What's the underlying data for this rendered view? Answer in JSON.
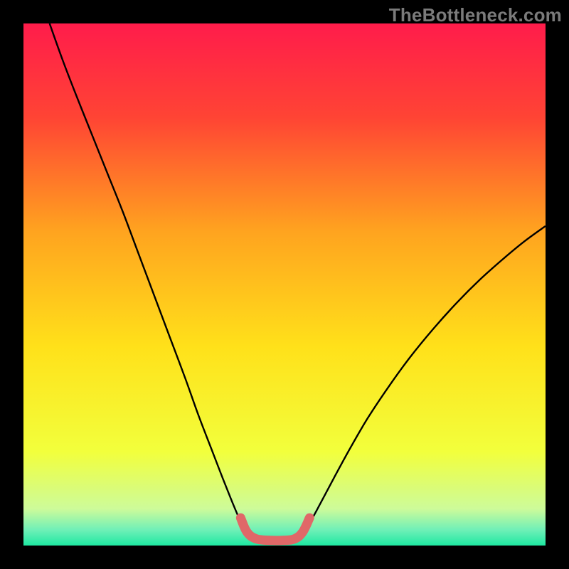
{
  "watermark": {
    "text": "TheBottleneck.com"
  },
  "chart_data": {
    "type": "line",
    "title": "",
    "xlabel": "",
    "ylabel": "",
    "xlim": [
      0,
      1
    ],
    "ylim": [
      0,
      1
    ],
    "grid": false,
    "legend": false,
    "background_gradient_stops": [
      {
        "offset": 0.0,
        "color": "#ff1c4b"
      },
      {
        "offset": 0.18,
        "color": "#ff4434"
      },
      {
        "offset": 0.4,
        "color": "#ffa41f"
      },
      {
        "offset": 0.62,
        "color": "#ffe11a"
      },
      {
        "offset": 0.82,
        "color": "#f2ff3c"
      },
      {
        "offset": 0.93,
        "color": "#cdfb9a"
      },
      {
        "offset": 0.97,
        "color": "#6ff0b7"
      },
      {
        "offset": 1.0,
        "color": "#1ee8a2"
      }
    ],
    "series": [
      {
        "name": "left-curve",
        "stroke": "#000000",
        "stroke_width": 2.4,
        "points": [
          {
            "x": 0.05,
            "y": 1.0
          },
          {
            "x": 0.075,
            "y": 0.93
          },
          {
            "x": 0.1,
            "y": 0.865
          },
          {
            "x": 0.13,
            "y": 0.79
          },
          {
            "x": 0.16,
            "y": 0.715
          },
          {
            "x": 0.19,
            "y": 0.64
          },
          {
            "x": 0.22,
            "y": 0.56
          },
          {
            "x": 0.25,
            "y": 0.48
          },
          {
            "x": 0.28,
            "y": 0.4
          },
          {
            "x": 0.31,
            "y": 0.32
          },
          {
            "x": 0.335,
            "y": 0.25
          },
          {
            "x": 0.36,
            "y": 0.185
          },
          {
            "x": 0.382,
            "y": 0.128
          },
          {
            "x": 0.4,
            "y": 0.083
          },
          {
            "x": 0.414,
            "y": 0.05
          },
          {
            "x": 0.423,
            "y": 0.032
          }
        ]
      },
      {
        "name": "right-curve",
        "stroke": "#000000",
        "stroke_width": 2.4,
        "points": [
          {
            "x": 0.54,
            "y": 0.032
          },
          {
            "x": 0.552,
            "y": 0.05
          },
          {
            "x": 0.57,
            "y": 0.083
          },
          {
            "x": 0.595,
            "y": 0.13
          },
          {
            "x": 0.625,
            "y": 0.185
          },
          {
            "x": 0.66,
            "y": 0.245
          },
          {
            "x": 0.7,
            "y": 0.305
          },
          {
            "x": 0.74,
            "y": 0.36
          },
          {
            "x": 0.785,
            "y": 0.415
          },
          {
            "x": 0.83,
            "y": 0.465
          },
          {
            "x": 0.875,
            "y": 0.51
          },
          {
            "x": 0.92,
            "y": 0.55
          },
          {
            "x": 0.96,
            "y": 0.583
          },
          {
            "x": 1.0,
            "y": 0.612
          }
        ]
      },
      {
        "name": "bottom-highlight",
        "stroke": "#e06868",
        "stroke_width": 13,
        "linecap": "round",
        "points": [
          {
            "x": 0.416,
            "y": 0.053
          },
          {
            "x": 0.428,
            "y": 0.026
          },
          {
            "x": 0.445,
            "y": 0.013
          },
          {
            "x": 0.47,
            "y": 0.01
          },
          {
            "x": 0.5,
            "y": 0.01
          },
          {
            "x": 0.52,
            "y": 0.013
          },
          {
            "x": 0.535,
            "y": 0.026
          },
          {
            "x": 0.548,
            "y": 0.053
          }
        ]
      }
    ]
  }
}
